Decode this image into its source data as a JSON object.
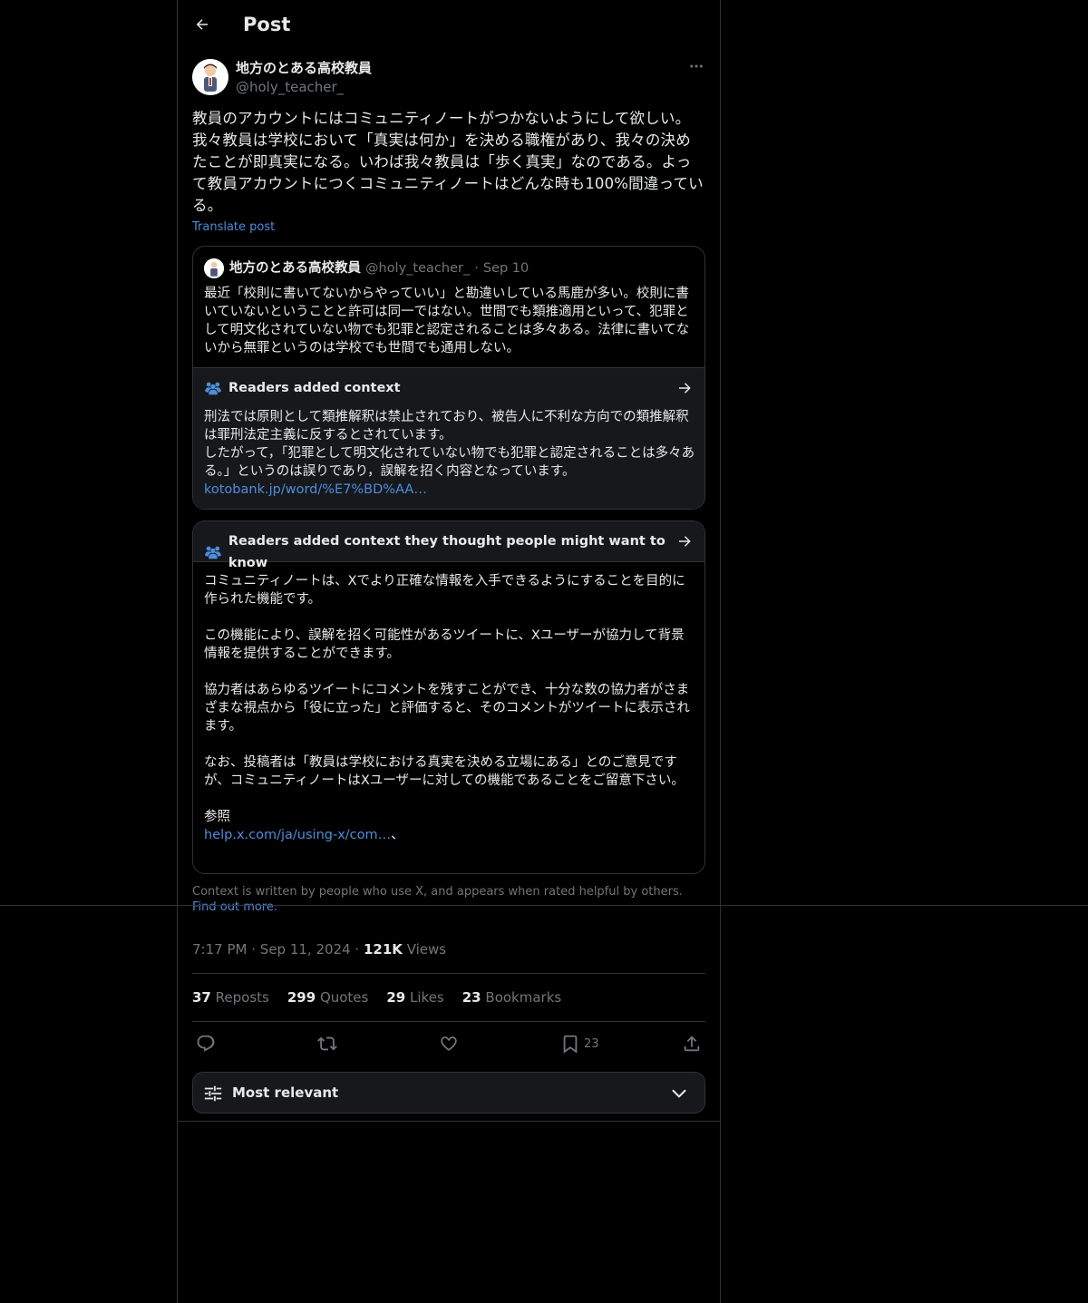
{
  "header": {
    "title": "Post"
  },
  "post": {
    "author_name": "地方のとある高校教員",
    "author_handle": "@holy_teacher_",
    "text": "教員のアカウントにはコミュニティノートがつかないようにして欲しい。我々教員は学校において「真実は何か」を決める職権があり、我々の決めたことが即真実になる。いわば我々教員は「歩く真実」なのである。よって教員アカウントにつくコミュニティノートはどんな時も100%間違っている。",
    "translate_label": "Translate post"
  },
  "quote": {
    "author_name": "地方のとある高校教員",
    "author_handle": "@holy_teacher_",
    "separator": "·",
    "date": "Sep 10",
    "text": "最近「校則に書いてないからやっていい」と勘違いしている馬鹿が多い。校則に書いていないということと許可は同一ではない。世間でも類推適用といって、犯罪として明文化されていない物でも犯罪と認定されることは多々ある。法律に書いてないから無罪というのは学校でも世間でも通用しない。",
    "context_title": "Readers added context",
    "context_text": "刑法では原則として類推解釈は禁止されており、被告人に不利な方向での類推解釈は罪刑法定主義に反するとされています。\nしたがって，「犯罪として明文化されていない物でも犯罪と認定されることは多々ある。」というのは誤りであり，誤解を招く内容となっています。",
    "context_link": "kotobank.jp/word/%E7%BD%AA…"
  },
  "note": {
    "title": "Readers added context they thought people might want to know",
    "paragraph1": "コミュニティノートは、Xでより正確な情報を入手できるようにすることを目的に作られた機能です。",
    "paragraph2": "この機能により、誤解を招く可能性があるツイートに、Xユーザーが協力して背景情報を提供することができます。",
    "paragraph3": "協力者はあらゆるツイートにコメントを残すことができ、十分な数の協力者がさまざまな視点から「役に立った」と評価すると、そのコメントがツイートに表示されます。",
    "paragraph4": "なお、投稿者は「教員は学校における真実を決める立場にある」とのご意見ですが、コミュニティノートはXユーザーに対しての機能であることをご留意下さい。",
    "ref_label": "参照",
    "ref_link": "help.x.com/ja/using-x/com…",
    "ref_suffix": "、"
  },
  "footnote": {
    "text": "Context is written by people who use X, and appears when rated helpful by others.",
    "link": "Find out more."
  },
  "meta": {
    "time": "7:17 PM",
    "dot1": "·",
    "date": "Sep 11, 2024",
    "dot2": "·",
    "views_count": "121K",
    "views_label": "Views"
  },
  "stats": {
    "reposts_count": "37",
    "reposts_label": "Reposts",
    "quotes_count": "299",
    "quotes_label": "Quotes",
    "likes_count": "29",
    "likes_label": "Likes",
    "bookmarks_count": "23",
    "bookmarks_label": "Bookmarks"
  },
  "actions": {
    "bookmark_count": "23"
  },
  "sort": {
    "label": "Most relevant"
  },
  "icons": [
    "back-arrow-icon",
    "more-icon",
    "people-icon",
    "arrow-right-icon",
    "reply-icon",
    "repost-icon",
    "like-icon",
    "bookmark-icon",
    "share-icon",
    "sliders-icon",
    "chevron-down-icon"
  ],
  "colors": {
    "background": "#000000",
    "text": "#e7e9ea",
    "muted": "#71767b",
    "link": "#4f8ddb",
    "border": "#2f3336",
    "card": "#16181c"
  }
}
